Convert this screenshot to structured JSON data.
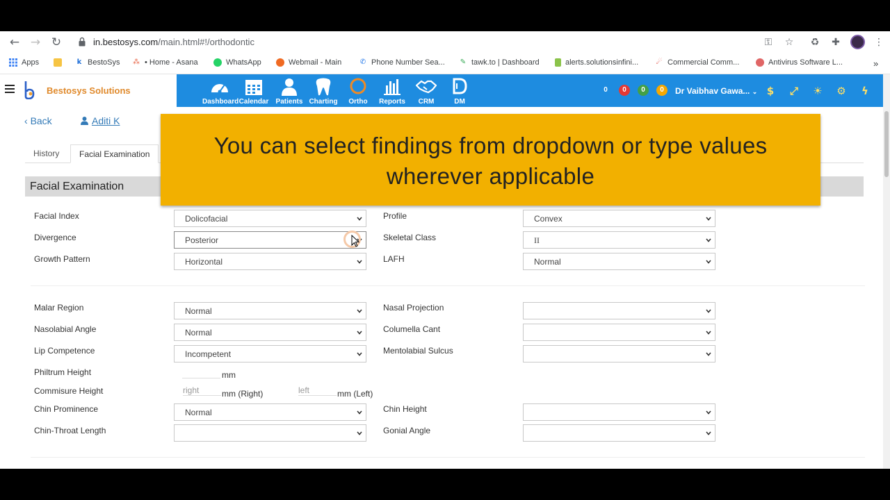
{
  "browser": {
    "url_host": "in.bestosys.com",
    "url_path": "/main.html#!/orthodontic",
    "bookmarks": [
      {
        "label": "Apps",
        "icon": "apps-grid-icon",
        "color": "#4285f4"
      },
      {
        "label": "",
        "icon": "folder-icon",
        "color": "#f6c443"
      },
      {
        "label": "BestoSys",
        "icon": "bestosys-icon",
        "color": "#1e6ed8"
      },
      {
        "label": "• Home - Asana",
        "icon": "asana-icon",
        "color": "#e8684a"
      },
      {
        "label": "WhatsApp",
        "icon": "whatsapp-icon",
        "color": "#25d366"
      },
      {
        "label": "Webmail - Main",
        "icon": "webmail-icon",
        "color": "#f06a22"
      },
      {
        "label": "Phone Number Sea...",
        "icon": "phone-icon",
        "color": "#1a73e8"
      },
      {
        "label": "tawk.to | Dashboard",
        "icon": "tawk-icon",
        "color": "#34a853"
      },
      {
        "label": "alerts.solutionsinfini...",
        "icon": "alerts-icon",
        "color": "#8bc34a"
      },
      {
        "label": "Commercial Comm...",
        "icon": "commercial-icon",
        "color": "#d93025"
      },
      {
        "label": "Antivirus Software L...",
        "icon": "antivirus-icon",
        "color": "#e06666"
      }
    ]
  },
  "app": {
    "brand": "Bestosys Solutions",
    "nav": [
      {
        "label": "Dashboard",
        "icon": "dashboard-gauge-icon"
      },
      {
        "label": "Calendar",
        "icon": "calendar-icon"
      },
      {
        "label": "Patients",
        "icon": "patient-person-icon"
      },
      {
        "label": "Charting",
        "icon": "tooth-icon"
      },
      {
        "label": "Ortho",
        "icon": "ortho-ring-icon"
      },
      {
        "label": "Reports",
        "icon": "bar-chart-icon"
      },
      {
        "label": "CRM",
        "icon": "handshake-icon"
      },
      {
        "label": "DM",
        "icon": "dm-icon"
      }
    ],
    "badges": [
      {
        "value": "0",
        "color": "#1e8ce0"
      },
      {
        "value": "0",
        "color": "#e53935"
      },
      {
        "value": "0",
        "color": "#43a047"
      },
      {
        "value": "0",
        "color": "#f6a800"
      }
    ],
    "user": "Dr Vaibhav Gawa...",
    "colors": {
      "primary": "#1e8ce0",
      "brand_orange": "#e08a2c",
      "toast": "#f2b000"
    }
  },
  "page": {
    "back_label": "Back",
    "patient_name": "Aditi K",
    "tabs": [
      "History",
      "Facial Examination"
    ],
    "active_tab": "Facial Examination",
    "section_title": "Facial Examination",
    "fields": {
      "facial_index": {
        "label": "Facial Index",
        "value": "Dolicofacial"
      },
      "profile": {
        "label": "Profile",
        "value": "Convex"
      },
      "divergence": {
        "label": "Divergence",
        "value": "Posterior"
      },
      "skeletal_class": {
        "label": "Skeletal Class",
        "value": "II"
      },
      "growth_pattern": {
        "label": "Growth Pattern",
        "value": "Horizontal"
      },
      "lafh": {
        "label": "LAFH",
        "value": "Normal"
      },
      "malar_region": {
        "label": "Malar Region",
        "value": "Normal"
      },
      "nasal_projection": {
        "label": "Nasal Projection",
        "value": ""
      },
      "nasolabial_angle": {
        "label": "Nasolabial Angle",
        "value": "Normal"
      },
      "columella_cant": {
        "label": "Columella Cant",
        "value": ""
      },
      "lip_competence": {
        "label": "Lip Competence",
        "value": "Incompetent"
      },
      "mentolabial_sulcus": {
        "label": "Mentolabial Sulcus",
        "value": ""
      },
      "philtrum_height": {
        "label": "Philtrum Height",
        "unit": "mm"
      },
      "commisure_height": {
        "label": "Commisure Height",
        "right_placeholder": "right",
        "right_unit": "mm (Right)",
        "left_placeholder": "left",
        "left_unit": "mm (Left)"
      },
      "chin_prominence": {
        "label": "Chin Prominence",
        "value": "Normal"
      },
      "chin_height": {
        "label": "Chin Height",
        "value": ""
      },
      "chin_throat_length": {
        "label": "Chin-Throat Length",
        "value": ""
      },
      "gonial_angle": {
        "label": "Gonial Angle",
        "value": ""
      }
    }
  },
  "tooltip": {
    "line1": "You can select findings from dropdown or type values",
    "line2": "wherever applicable"
  }
}
